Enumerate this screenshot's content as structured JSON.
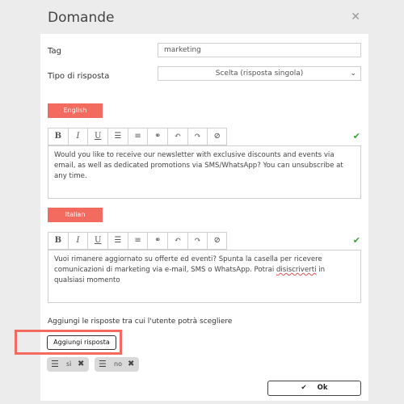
{
  "dialog": {
    "title": "Domande",
    "close_icon": "close-icon"
  },
  "tag": {
    "label": "Tag",
    "value": "marketing"
  },
  "response_type": {
    "label": "Tipo di risposta",
    "selected": "Scelta (risposta singola)"
  },
  "languages": [
    {
      "label": "English",
      "text": "Would you like to receive our newsletter with exclusive discounts and events via email, as well as dedicated promotions via SMS/WhatsApp? You can unsubscribe at any time.",
      "validated": true
    },
    {
      "label": "Italian",
      "text_before": "Vuoi rimanere aggiornato su offerte ed eventi? Spunta la casella per ricevere comunicazioni di marketing via e-mail, SMS o WhatsApp. Potrai ",
      "text_misspelled": "disiscriverti",
      "text_after": " in qualsiasi momento",
      "validated": true
    }
  ],
  "toolbar_buttons": [
    "bold-icon",
    "italic-icon",
    "underline-icon",
    "bullet-list-icon",
    "numbered-list-icon",
    "link-icon",
    "undo-icon",
    "redo-icon",
    "clear-format-icon"
  ],
  "answers": {
    "hint": "Aggiungi le risposte tra cui l'utente potrà scegliere",
    "add_button": "Aggiungi risposta",
    "items": [
      {
        "label": "sì"
      },
      {
        "label": "no"
      }
    ]
  },
  "footer": {
    "ok_label": "Ok"
  },
  "colors": {
    "accent": "#f26b5e",
    "check": "#3aa23a",
    "chip": "#d9d9d9"
  }
}
